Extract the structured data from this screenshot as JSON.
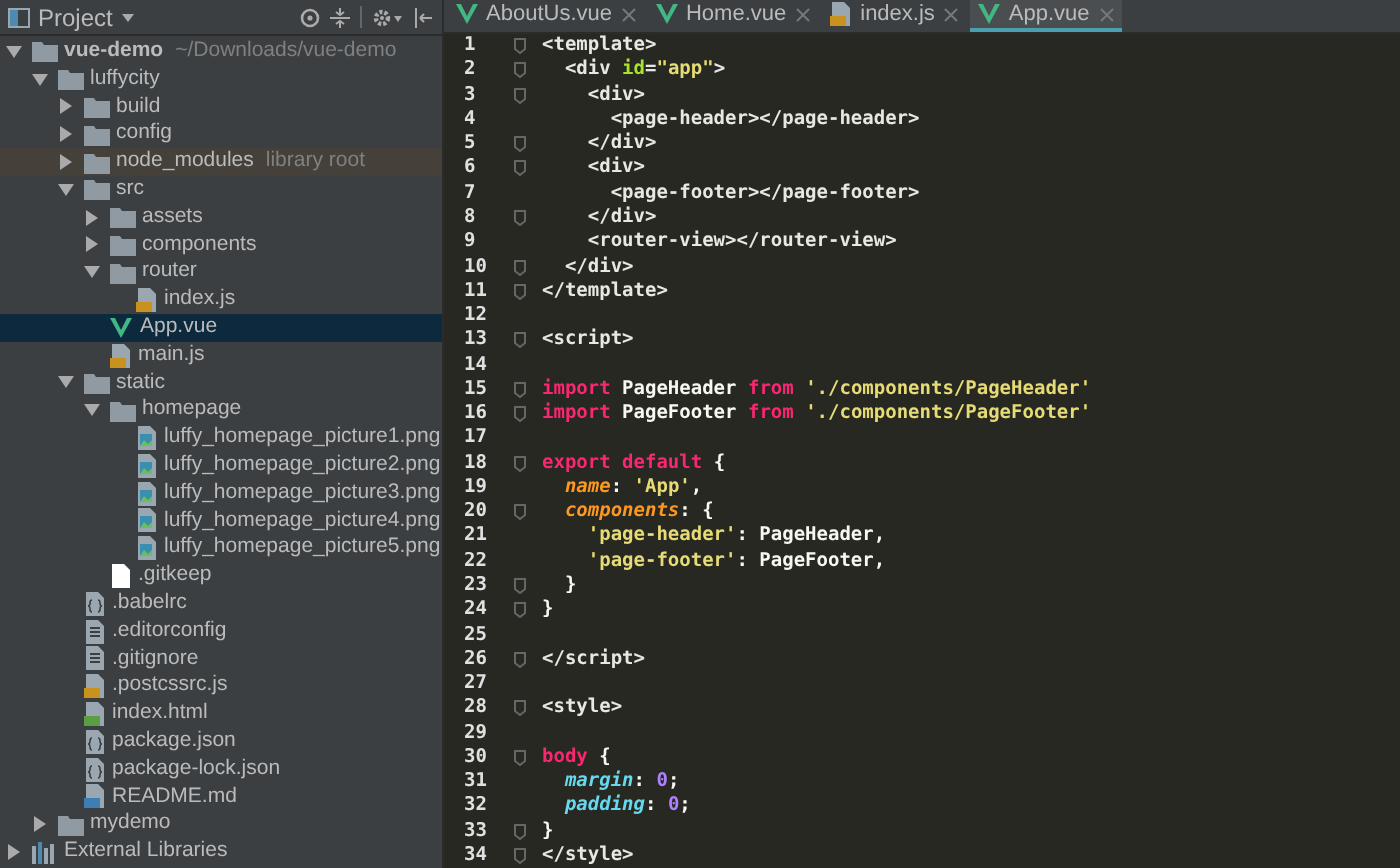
{
  "project_panel": {
    "title": "Project"
  },
  "tree": [
    {
      "name": "vue-demo",
      "kind": "folder",
      "note": "~/Downloads/vue-demo",
      "expanded": true,
      "selected": false,
      "children": [
        {
          "name": "luffycity",
          "kind": "folder",
          "expanded": true,
          "selected": false,
          "children": [
            {
              "name": "build",
              "kind": "folder",
              "expanded": false,
              "selected": false
            },
            {
              "name": "config",
              "kind": "folder",
              "expanded": false,
              "selected": false
            },
            {
              "name": "node_modules",
              "kind": "library_folder",
              "note": "library root",
              "expanded": false,
              "selected": false
            },
            {
              "name": "src",
              "kind": "folder",
              "expanded": true,
              "selected": false,
              "children": [
                {
                  "name": "assets",
                  "kind": "folder",
                  "expanded": false,
                  "selected": false
                },
                {
                  "name": "components",
                  "kind": "folder",
                  "expanded": false,
                  "selected": false
                },
                {
                  "name": "router",
                  "kind": "folder",
                  "expanded": true,
                  "selected": false,
                  "children": [
                    {
                      "name": "index.js",
                      "kind": "js",
                      "selected": false
                    }
                  ]
                },
                {
                  "name": "App.vue",
                  "kind": "vue",
                  "selected": true
                },
                {
                  "name": "main.js",
                  "kind": "js",
                  "selected": false
                }
              ]
            },
            {
              "name": "static",
              "kind": "folder",
              "expanded": true,
              "selected": false,
              "children": [
                {
                  "name": "homepage",
                  "kind": "folder",
                  "expanded": true,
                  "selected": false,
                  "children": [
                    {
                      "name": "luffy_homepage_picture1.png",
                      "kind": "image",
                      "selected": false
                    },
                    {
                      "name": "luffy_homepage_picture2.png",
                      "kind": "image",
                      "selected": false
                    },
                    {
                      "name": "luffy_homepage_picture3.png",
                      "kind": "image",
                      "selected": false
                    },
                    {
                      "name": "luffy_homepage_picture4.png",
                      "kind": "image",
                      "selected": false
                    },
                    {
                      "name": "luffy_homepage_picture5.png",
                      "kind": "image",
                      "selected": false
                    }
                  ]
                },
                {
                  "name": ".gitkeep",
                  "kind": "blank",
                  "selected": false
                }
              ]
            },
            {
              "name": ".babelrc",
              "kind": "config",
              "selected": false
            },
            {
              "name": ".editorconfig",
              "kind": "text",
              "selected": false
            },
            {
              "name": ".gitignore",
              "kind": "text",
              "selected": false
            },
            {
              "name": ".postcssrc.js",
              "kind": "js",
              "selected": false
            },
            {
              "name": "index.html",
              "kind": "html",
              "selected": false
            },
            {
              "name": "package.json",
              "kind": "config",
              "selected": false
            },
            {
              "name": "package-lock.json",
              "kind": "config",
              "selected": false
            },
            {
              "name": "README.md",
              "kind": "md",
              "selected": false
            }
          ]
        },
        {
          "name": "mydemo",
          "kind": "folder",
          "expanded": false,
          "selected": false
        }
      ]
    },
    {
      "name": "External Libraries",
      "kind": "libraries",
      "expanded": false,
      "selected": false
    }
  ],
  "tabs": [
    {
      "label": "AboutUs.vue",
      "kind": "vue",
      "selected": false
    },
    {
      "label": "Home.vue",
      "kind": "vue",
      "selected": false
    },
    {
      "label": "index.js",
      "kind": "js",
      "selected": false
    },
    {
      "label": "App.vue",
      "kind": "vue",
      "selected": true
    }
  ],
  "code_lines": [
    {
      "n": "1",
      "fold": true,
      "tokens": [
        {
          "text": "<template>",
          "kind": "tag"
        }
      ]
    },
    {
      "n": "2",
      "fold": true,
      "tokens": [
        {
          "text": "  <div ",
          "kind": "tag"
        },
        {
          "text": "id",
          "kind": "attr"
        },
        {
          "text": "=",
          "kind": "tag"
        },
        {
          "text": "\"app\"",
          "kind": "str"
        },
        {
          "text": ">",
          "kind": "tag"
        }
      ]
    },
    {
      "n": "3",
      "fold": true,
      "tokens": [
        {
          "text": "    <div>",
          "kind": "tag"
        }
      ]
    },
    {
      "n": "4",
      "fold": false,
      "tokens": [
        {
          "text": "      <page-header></page-header>",
          "kind": "tag"
        }
      ]
    },
    {
      "n": "5",
      "fold": true,
      "tokens": [
        {
          "text": "    </div>",
          "kind": "tag"
        }
      ]
    },
    {
      "n": "6",
      "fold": true,
      "tokens": [
        {
          "text": "    <div>",
          "kind": "tag"
        }
      ]
    },
    {
      "n": "7",
      "fold": false,
      "tokens": [
        {
          "text": "      <page-footer></page-footer>",
          "kind": "tag"
        }
      ]
    },
    {
      "n": "8",
      "fold": true,
      "tokens": [
        {
          "text": "    </div>",
          "kind": "tag"
        }
      ]
    },
    {
      "n": "9",
      "fold": false,
      "tokens": [
        {
          "text": "    <router-view></router-view>",
          "kind": "tag"
        }
      ]
    },
    {
      "n": "10",
      "fold": true,
      "tokens": [
        {
          "text": "  </div>",
          "kind": "tag"
        }
      ]
    },
    {
      "n": "11",
      "fold": true,
      "tokens": [
        {
          "text": "</template>",
          "kind": "tag"
        }
      ]
    },
    {
      "n": "12",
      "fold": false
    },
    {
      "n": "13",
      "fold": true,
      "tokens": [
        {
          "text": "<script>",
          "kind": "tag"
        }
      ]
    },
    {
      "n": "14",
      "fold": false
    },
    {
      "n": "15",
      "fold": true,
      "tokens": [
        {
          "text": "import",
          "kind": "kw"
        },
        {
          "text": " PageHeader ",
          "kind": "plain"
        },
        {
          "text": "from",
          "kind": "kw"
        },
        {
          "text": " './components/PageHeader'",
          "kind": "str"
        }
      ]
    },
    {
      "n": "16",
      "fold": true,
      "tokens": [
        {
          "text": "import",
          "kind": "kw"
        },
        {
          "text": " PageFooter ",
          "kind": "plain"
        },
        {
          "text": "from",
          "kind": "kw"
        },
        {
          "text": " './components/PageFooter'",
          "kind": "str"
        }
      ]
    },
    {
      "n": "17",
      "fold": false
    },
    {
      "n": "18",
      "fold": true,
      "tokens": [
        {
          "text": "export",
          "kind": "kw"
        },
        {
          "text": " default",
          "kind": "kw"
        },
        {
          "text": " {",
          "kind": "plain"
        }
      ]
    },
    {
      "n": "19",
      "fold": false,
      "tokens": [
        {
          "text": "  name",
          "kind": "prop"
        },
        {
          "text": ": ",
          "kind": "plain"
        },
        {
          "text": "'App'",
          "kind": "str"
        },
        {
          "text": ",",
          "kind": "plain"
        }
      ]
    },
    {
      "n": "20",
      "fold": true,
      "tokens": [
        {
          "text": "  components",
          "kind": "prop"
        },
        {
          "text": ": {",
          "kind": "plain"
        }
      ]
    },
    {
      "n": "21",
      "fold": false,
      "tokens": [
        {
          "text": "    'page-header'",
          "kind": "str"
        },
        {
          "text": ": PageHeader,",
          "kind": "plain"
        }
      ]
    },
    {
      "n": "22",
      "fold": false,
      "tokens": [
        {
          "text": "    'page-footer'",
          "kind": "str"
        },
        {
          "text": ": PageFooter,",
          "kind": "plain"
        }
      ]
    },
    {
      "n": "23",
      "fold": true,
      "tokens": [
        {
          "text": "  }",
          "kind": "plain"
        }
      ]
    },
    {
      "n": "24",
      "fold": true,
      "tokens": [
        {
          "text": "}",
          "kind": "plain"
        }
      ]
    },
    {
      "n": "25",
      "fold": false
    },
    {
      "n": "26",
      "fold": true,
      "tokens": [
        {
          "text": "</script>",
          "kind": "tag"
        }
      ]
    },
    {
      "n": "27",
      "fold": false
    },
    {
      "n": "28",
      "fold": true,
      "tokens": [
        {
          "text": "<style>",
          "kind": "tag"
        }
      ]
    },
    {
      "n": "29",
      "fold": false
    },
    {
      "n": "30",
      "fold": true,
      "tokens": [
        {
          "text": "body",
          "kind": "kw"
        },
        {
          "text": " {",
          "kind": "plain"
        }
      ]
    },
    {
      "n": "31",
      "fold": false,
      "tokens": [
        {
          "text": "  margin",
          "kind": "cssprop"
        },
        {
          "text": ": ",
          "kind": "plain"
        },
        {
          "text": "0",
          "kind": "num"
        },
        {
          "text": ";",
          "kind": "plain"
        }
      ]
    },
    {
      "n": "32",
      "fold": false,
      "tokens": [
        {
          "text": "  padding",
          "kind": "cssprop"
        },
        {
          "text": ": ",
          "kind": "plain"
        },
        {
          "text": "0",
          "kind": "num"
        },
        {
          "text": ";",
          "kind": "plain"
        }
      ]
    },
    {
      "n": "33",
      "fold": true,
      "tokens": [
        {
          "text": "}",
          "kind": "plain"
        }
      ]
    },
    {
      "n": "34",
      "fold": true,
      "tokens": [
        {
          "text": "</style>",
          "kind": "tag"
        }
      ]
    }
  ]
}
